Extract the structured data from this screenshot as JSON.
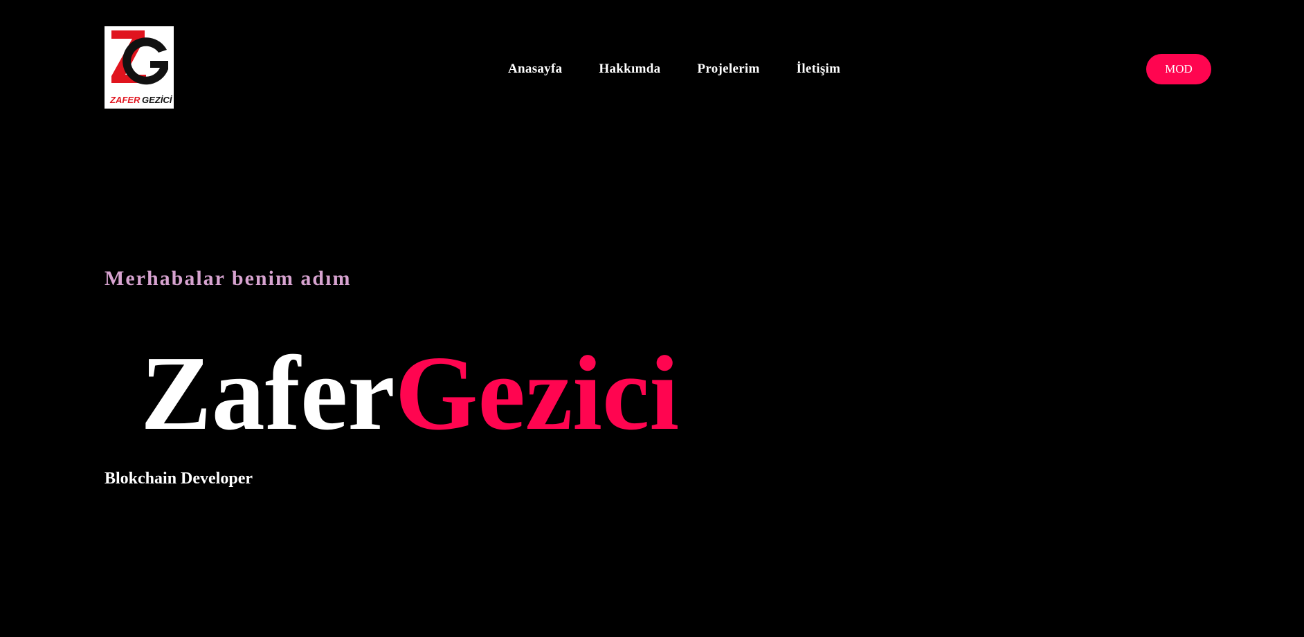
{
  "header": {
    "logo": {
      "icon": "zg-monogram-logo",
      "text_red": "ZAFER",
      "text_black": "GEZİCİ"
    },
    "nav": [
      {
        "label": "Anasayfa"
      },
      {
        "label": "Hakkımda"
      },
      {
        "label": "Projelerim"
      },
      {
        "label": "İletişim"
      }
    ],
    "mode_button": "MOD"
  },
  "hero": {
    "greeting": "Merhabalar benim adım",
    "first_name": "Zafer",
    "last_name": "Gezici",
    "role": "Blokchain Developer"
  },
  "colors": {
    "background": "#000000",
    "accent": "#ff0550",
    "greeting": "#d7a3d0",
    "text": "#ffffff"
  }
}
